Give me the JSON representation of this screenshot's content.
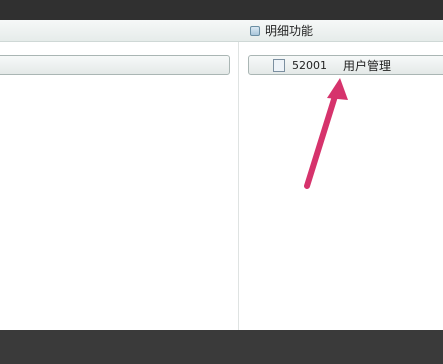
{
  "detail_panel": {
    "title": "明细功能",
    "items": [
      {
        "code": "52001",
        "name": "用户管理"
      }
    ]
  },
  "colors": {
    "annotation_arrow": "#d6336c",
    "title_bar": "#303030",
    "status_bar": "#3a3a3a"
  },
  "icons": {
    "title_bullet": "square-bullet-icon",
    "item_icon": "page-icon"
  }
}
